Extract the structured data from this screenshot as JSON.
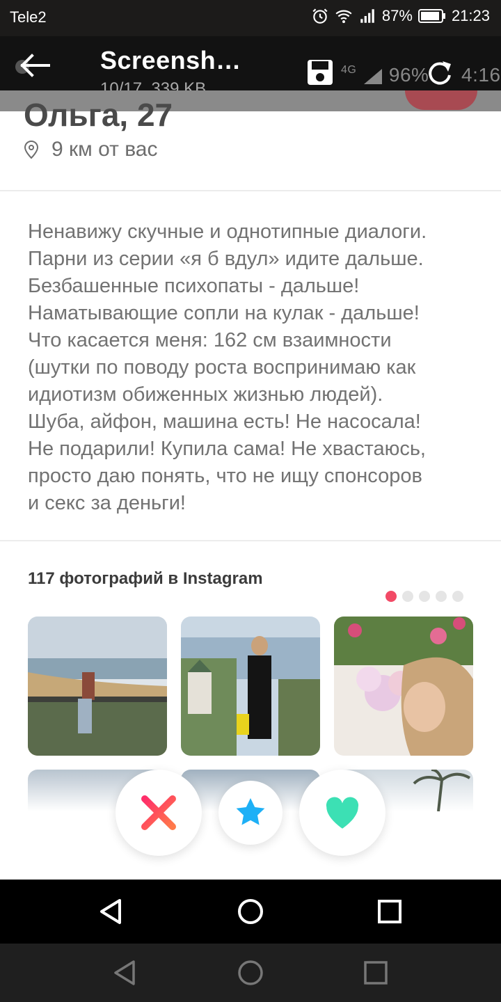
{
  "status_bar": {
    "carrier": "Tele2",
    "battery": "87%",
    "time": "21:23"
  },
  "viewer": {
    "title": "Screensh…",
    "subtitle": "10/17, 339 KB",
    "ghost_status": "96%",
    "ghost_time": "4:16",
    "ghost_network": "4G"
  },
  "profile": {
    "name_age": "Ольга, 27",
    "distance": "9 км от вас",
    "bio_lines": [
      "Ненавижу скучные и однотипные диалоги.",
      "Парни из серии «я б вдул» идите дальше.",
      "Безбашенные психопаты - дальше!",
      "Наматывающие сопли на кулак - дальше!",
      "Что касается меня: 162 см взаимности",
      "(шутки по поводу роста воспринимаю как",
      "идиотизм обиженных жизнью людей).",
      "Шуба, айфон, машина есть! Не насосала!",
      "Не подарили! Купила сама! Не хвастаюсь,",
      "просто даю понять, что не ищу спонсоров",
      "и секс за деньги!"
    ]
  },
  "instagram": {
    "title": "117 фотографий в Instagram",
    "pages": 5,
    "active_page": 1
  },
  "actions": {
    "nope_icon": "x-icon",
    "superlike_icon": "star-icon",
    "like_icon": "heart-icon"
  },
  "colors": {
    "nope": "#fd5068",
    "superlike": "#1eb0f6",
    "like": "#3ce0b4",
    "accent": "#f24a66"
  }
}
